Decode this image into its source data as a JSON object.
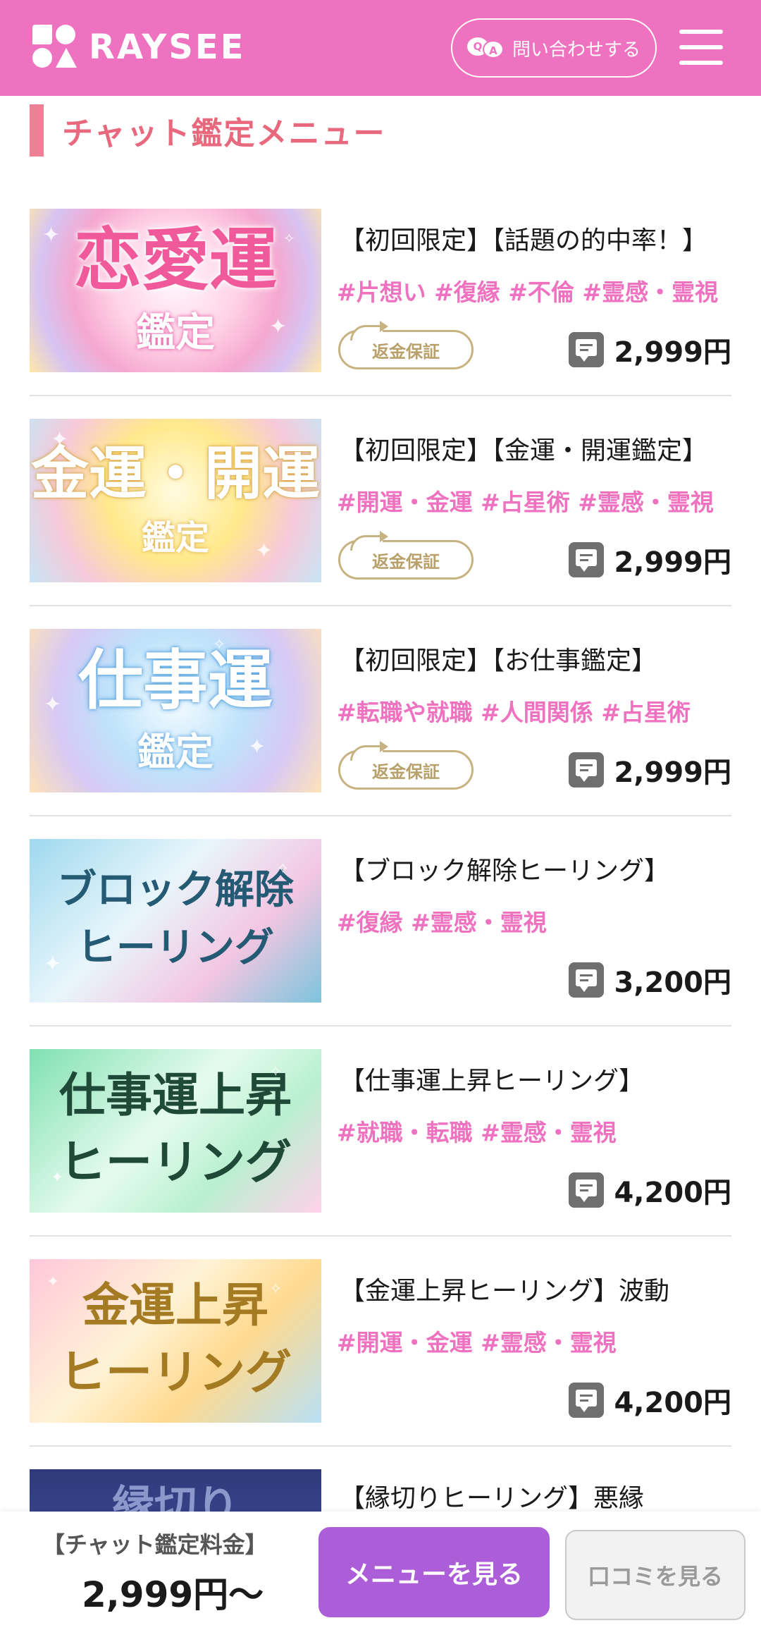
{
  "header": {
    "brand": "RAYSEE",
    "contact_label": "問い合わせする",
    "qa_q": "Q",
    "qa_a": "A"
  },
  "section": {
    "title": "チャット鑑定メニュー"
  },
  "colors": {
    "header_bg": "#ee72bf",
    "tag_pink": "#ee72bf",
    "accent_title": "#e8697e",
    "menu_button": "#ac5dd8"
  },
  "items": [
    {
      "thumb_big": "恋愛運",
      "thumb_small": "鑑定",
      "title": "【初回限定】【話題の的中率！】",
      "tags": "#片想い  #復縁  #不倫  #霊感・霊視",
      "guarantee": "返金保証",
      "price": "2,999円"
    },
    {
      "thumb_big": "金運・開運",
      "thumb_small": "鑑定",
      "title": "【初回限定】【金運・開運鑑定】",
      "tags": "#開運・金運  #占星術  #霊感・霊視",
      "guarantee": "返金保証",
      "price": "2,999円"
    },
    {
      "thumb_big": "仕事運",
      "thumb_small": "鑑定",
      "title": "【初回限定】【お仕事鑑定】",
      "tags": "#転職や就職  #人間関係  #占星術",
      "guarantee": "返金保証",
      "price": "2,999円"
    },
    {
      "thumb_big": "ブロック解除",
      "thumb_small": "ヒーリング",
      "title": "【ブロック解除ヒーリング】",
      "tags": "#復縁  #霊感・霊視",
      "price": "3,200円"
    },
    {
      "thumb_big": "仕事運上昇",
      "thumb_small": "ヒーリング",
      "title": "【仕事運上昇ヒーリング】",
      "tags": "#就職・転職  #霊感・霊視",
      "price": "4,200円"
    },
    {
      "thumb_big": "金運上昇",
      "thumb_small": "ヒーリング",
      "title": "【金運上昇ヒーリング】波動",
      "tags": "#開運・金運  #霊感・霊視",
      "price": "4,200円"
    },
    {
      "thumb_big": "縁切り",
      "title": "【縁切りヒーリング】悪縁"
    }
  ],
  "footer": {
    "fee_label": "【チャット鑑定料金】",
    "fee_price": "2,999円〜",
    "menu_button": "メニューを見る",
    "review_button": "口コミを見る"
  }
}
